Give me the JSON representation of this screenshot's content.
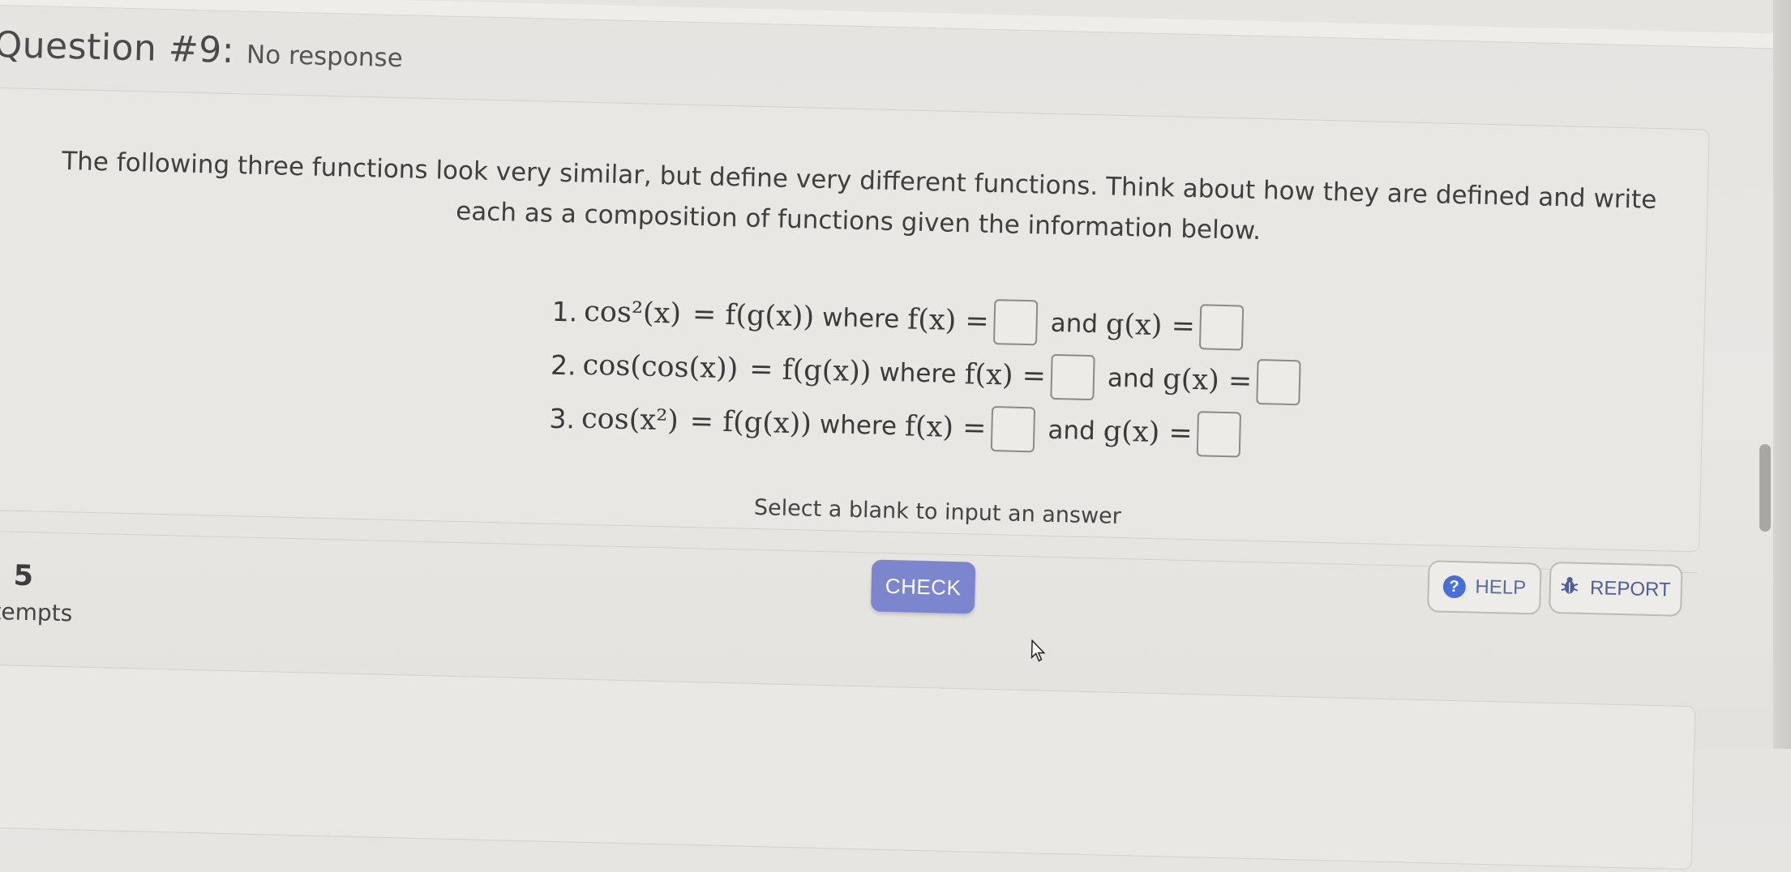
{
  "question": {
    "title": "Question #9:",
    "status": "No response"
  },
  "instructions": "The following three functions look very similar, but define very different functions. Think about how they are defined and write each as a composition of functions given the information below.",
  "problems": [
    {
      "number": "1.",
      "lhs": "cos²(x)",
      "composition": "= f(g(x))",
      "where_label": "where",
      "f_label": "f(x) =",
      "and_label": "and",
      "g_label": "g(x) ="
    },
    {
      "number": "2.",
      "lhs": "cos(cos(x))",
      "composition": "= f(g(x))",
      "where_label": "where",
      "f_label": "f(x) =",
      "and_label": "and",
      "g_label": "g(x) ="
    },
    {
      "number": "3.",
      "lhs": "cos(x²)",
      "composition": "= f(g(x))",
      "where_label": "where",
      "f_label": "f(x) =",
      "and_label": "and",
      "g_label": "g(x) ="
    }
  ],
  "hint": "Select a blank to input an answer",
  "attempts": {
    "count": "5",
    "label": "ttempts"
  },
  "buttons": {
    "check": "CHECK",
    "help": "HELP",
    "report": "REPORT"
  },
  "icons": {
    "help": "question-circle-icon",
    "report": "bug-icon",
    "cursor": "mouse-pointer-icon"
  },
  "colors": {
    "check_button": "#7b86cf",
    "help_icon": "#4a6ed8",
    "link_text": "#5a6b9e"
  }
}
